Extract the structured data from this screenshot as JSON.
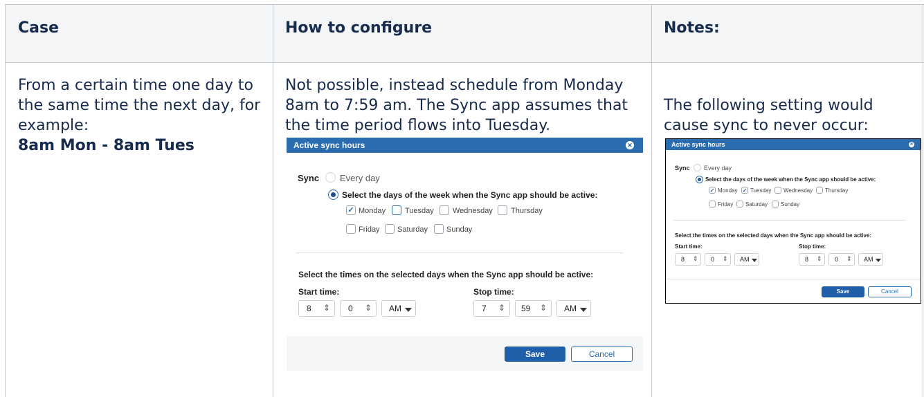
{
  "table": {
    "headers": [
      "Case",
      "How to configure",
      "Notes:"
    ],
    "case_text": [
      "From a certain time one day to",
      "the same time the next day, for",
      "example:"
    ],
    "case_bold": "8am Mon - 8am Tues",
    "config_text": [
      "Not possible, instead schedule from Monday",
      "8am to 7:59 am. The Sync app assumes that",
      "the time period flows into Tuesday."
    ],
    "notes_text": [
      "The following setting would",
      "cause sync to never occur:"
    ]
  },
  "dialog_main": {
    "title": "Active sync hours",
    "close_glyph": "✕",
    "sync_label": "Sync",
    "option_every_day": "Every day",
    "option_select_days": "Select the days of the week when the Sync app should be active:",
    "days": [
      {
        "label": "Monday",
        "checked": true
      },
      {
        "label": "Tuesday",
        "checked": false
      },
      {
        "label": "Wednesday",
        "checked": false
      },
      {
        "label": "Thursday",
        "checked": false
      },
      {
        "label": "Friday",
        "checked": false
      },
      {
        "label": "Saturday",
        "checked": false
      },
      {
        "label": "Sunday",
        "checked": false
      }
    ],
    "times_heading": "Select the times on the selected days when the Sync app should be active:",
    "start_label": "Start time:",
    "stop_label": "Stop time:",
    "start_hour": "8",
    "start_minute": "0",
    "start_ampm": "AM",
    "stop_hour": "7",
    "stop_minute": "59",
    "stop_ampm": "AM",
    "save_label": "Save",
    "cancel_label": "Cancel",
    "check_glyph": "✓",
    "spin_glyph": "⇕"
  },
  "dialog_notes": {
    "title": "Active sync hours",
    "close_glyph": "✕",
    "sync_label": "Sync",
    "option_every_day": "Every day",
    "option_select_days": "Select the days of the week when the Sync app should be active:",
    "days": [
      {
        "label": "Monday",
        "checked": true
      },
      {
        "label": "Tuesday",
        "checked": true
      },
      {
        "label": "Wednesday",
        "checked": false
      },
      {
        "label": "Thursday",
        "checked": false
      },
      {
        "label": "Friday",
        "checked": false
      },
      {
        "label": "Saturday",
        "checked": false
      },
      {
        "label": "Sunday",
        "checked": false
      }
    ],
    "times_heading": "Select the times on the selected days when the Sync app should be active:",
    "start_label": "Start time:",
    "stop_label": "Stop time:",
    "start_hour": "8",
    "start_minute": "0",
    "start_ampm": "AM",
    "stop_hour": "8",
    "stop_minute": "0",
    "stop_ampm": "AM",
    "save_label": "Save",
    "cancel_label": "Cancel",
    "check_glyph": "✓",
    "spin_glyph": "⇕"
  },
  "colors": {
    "title_bar": "#2a6cb0",
    "save_button": "#1f5fa8",
    "header_bg": "#f4f5f7",
    "grid": "#c1c7d0"
  }
}
